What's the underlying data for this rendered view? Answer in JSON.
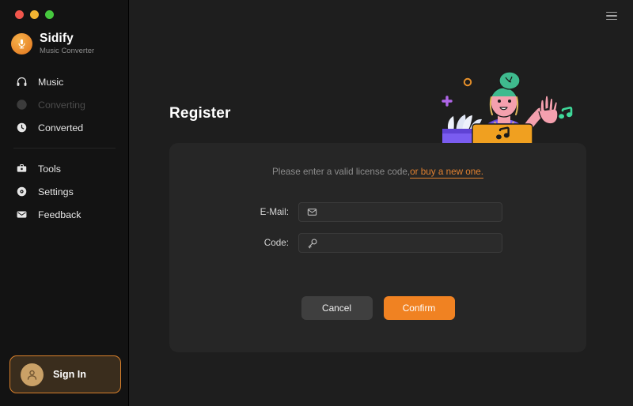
{
  "window": {
    "controls": [
      "close",
      "minimize",
      "maximize"
    ]
  },
  "brand": {
    "name": "Sidify",
    "subtitle": "Music Converter",
    "logo_icon": "microphone-icon",
    "logo_color": "#e8862a"
  },
  "sidebar": {
    "group_primary": [
      {
        "label": "Music",
        "icon": "headphones-icon",
        "state": "active"
      },
      {
        "label": "Converting",
        "icon": "converting-icon",
        "state": "disabled"
      },
      {
        "label": "Converted",
        "icon": "clock-icon",
        "state": "active"
      }
    ],
    "group_secondary": [
      {
        "label": "Tools",
        "icon": "toolbox-icon",
        "state": "active"
      },
      {
        "label": "Settings",
        "icon": "gear-icon",
        "state": "active"
      },
      {
        "label": "Feedback",
        "icon": "envelope-icon",
        "state": "active"
      }
    ],
    "sign_in": {
      "label": "Sign In",
      "icon": "person-icon",
      "border_color": "#d9802b",
      "background_color": "#3a2d1d"
    }
  },
  "header": {
    "menu_icon": "hamburger-icon"
  },
  "main": {
    "title": "Register",
    "illustration": {
      "name": "person-waving-at-laptop-illustration",
      "colors": {
        "hair": "#3fba8e",
        "skin": "#f4a0ae",
        "shirt": "#7a5cf0",
        "laptop": "#f0a020",
        "note": "#1b1b1b",
        "sparkle_purple": "#b066e8",
        "sparkle_orange": "#e8912a",
        "music_note_green": "#3fd99a",
        "fan_light": "#dfe6f5"
      }
    },
    "card": {
      "hint_text": "Please enter a valid license code,",
      "hint_link": "or buy a new one.",
      "link_color": "#e08030",
      "fields": [
        {
          "label": "E-Mail:",
          "icon": "envelope-icon",
          "value": "",
          "placeholder": ""
        },
        {
          "label": "Code:",
          "icon": "key-icon",
          "value": "",
          "placeholder": ""
        }
      ],
      "buttons": {
        "cancel": "Cancel",
        "confirm": "Confirm",
        "confirm_color": "#f08222",
        "cancel_color": "#3f3f3f"
      }
    }
  }
}
